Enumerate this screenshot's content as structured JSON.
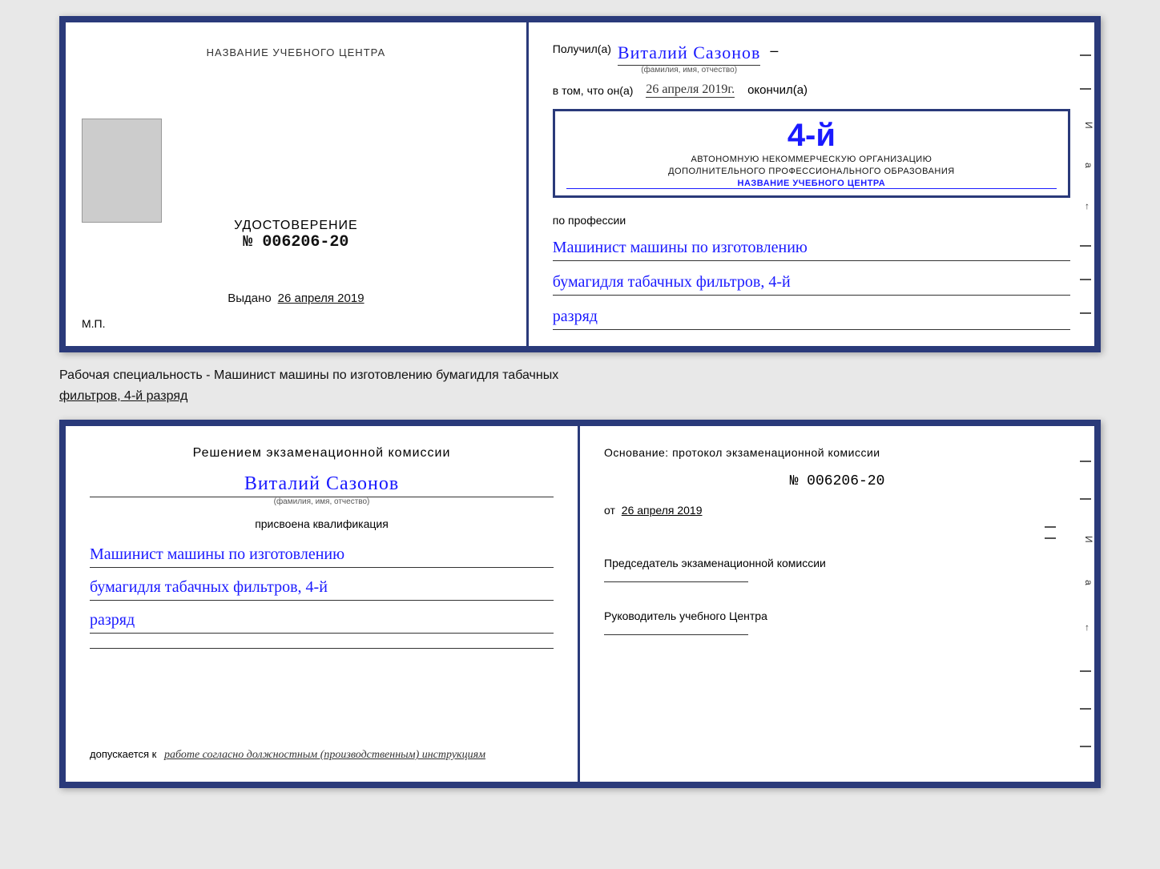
{
  "top_cert": {
    "left": {
      "header_label": "НАЗВАНИЕ УЧЕБНОГО ЦЕНТРА",
      "udostoverenie": "УДОСТОВЕРЕНИЕ",
      "number": "№ 006206-20",
      "vydano_prefix": "Выдано",
      "vydano_date": "26 апреля 2019",
      "mp": "М.П."
    },
    "right": {
      "poluchil_prefix": "Получил(а)",
      "name": "Виталий Сазонов",
      "name_sub": "(фамилия, имя, отчество)",
      "dash": "–",
      "vtom_prefix": "в том, что он(а)",
      "date": "26 апреля 2019г.",
      "okonchil": "окончил(а)",
      "stamp_num": "4-й",
      "stamp_line1": "АВТОНОМНУЮ НЕКОММЕРЧЕСКУЮ ОРГАНИЗАЦИЮ",
      "stamp_line2": "ДОПОЛНИТЕЛЬНОГО ПРОФЕССИОНАЛЬНОГО ОБРАЗОВАНИЯ",
      "stamp_line3": "НАЗВАНИЕ УЧЕБНОГО ЦЕНТРА",
      "i_letter": "И",
      "a_letter": "а",
      "arrow": "←",
      "po_professii": "по профессии",
      "profession1": "Машинист машины по изготовлению",
      "profession2": "бумагидля табачных фильтров, 4-й",
      "profession3": "разряд"
    }
  },
  "specialty_bar": {
    "text": "Рабочая специальность - Машинист машины по изготовлению бумагидля табачных",
    "underline_text": "фильтров, 4-й разряд"
  },
  "bottom_cert": {
    "left": {
      "resheniem": "Решением экзаменационной комиссии",
      "name": "Виталий Сазонов",
      "name_sub": "(фамилия, имя, отчество)",
      "prisvoena": "присвоена квалификация",
      "qual1": "Машинист машины по изготовлению",
      "qual2": "бумагидля табачных фильтров, 4-й",
      "qual3": "разряд",
      "dopuskaetsya_prefix": "допускается к",
      "dopuskaetsya_text": "работе согласно должностным (производственным) инструкциям"
    },
    "right": {
      "osnovaniye": "Основание: протокол экзаменационной комиссии",
      "protocol_num": "№ 006206-20",
      "ot_prefix": "от",
      "ot_date": "26 апреля 2019",
      "predsedatel_title": "Председатель экзаменационной комиссии",
      "rukovoditel_title": "Руководитель учебного Центра",
      "i_letter": "И",
      "a_letter": "а",
      "arrow": "←"
    }
  }
}
